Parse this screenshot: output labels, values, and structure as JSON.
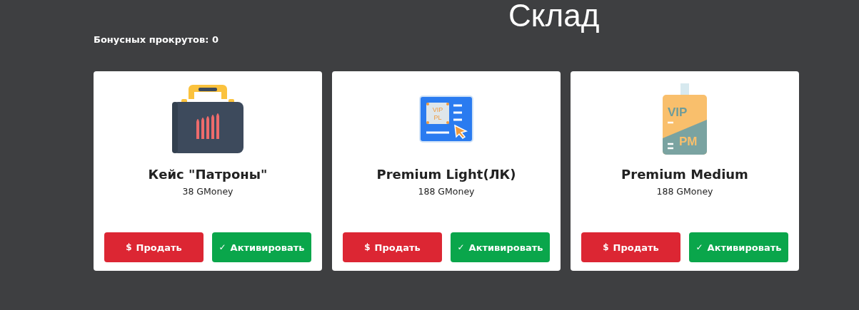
{
  "page": {
    "title": "Склад",
    "bonus": "Бонусных прокрутов: 0"
  },
  "items": [
    {
      "name": "Кейс \"Патроны\"",
      "price": "38 GMoney",
      "kind": "case",
      "sell": "Продать",
      "sell_icon": "$",
      "activate": "Активировать",
      "activate_icon": "✓"
    },
    {
      "name": "Premium Light(ЛК)",
      "price": "188 GMoney",
      "kind": "card",
      "icon_text": [
        "VIP",
        "PL"
      ],
      "sell": "Продать",
      "sell_icon": "$",
      "activate": "Активировать",
      "activate_icon": "✓"
    },
    {
      "name": "Premium Medium",
      "price": "188 GMoney",
      "kind": "badge",
      "icon_text": [
        "VIP",
        "PM"
      ],
      "sell": "Продать",
      "sell_icon": "$",
      "activate": "Активировать",
      "activate_icon": "✓"
    }
  ]
}
